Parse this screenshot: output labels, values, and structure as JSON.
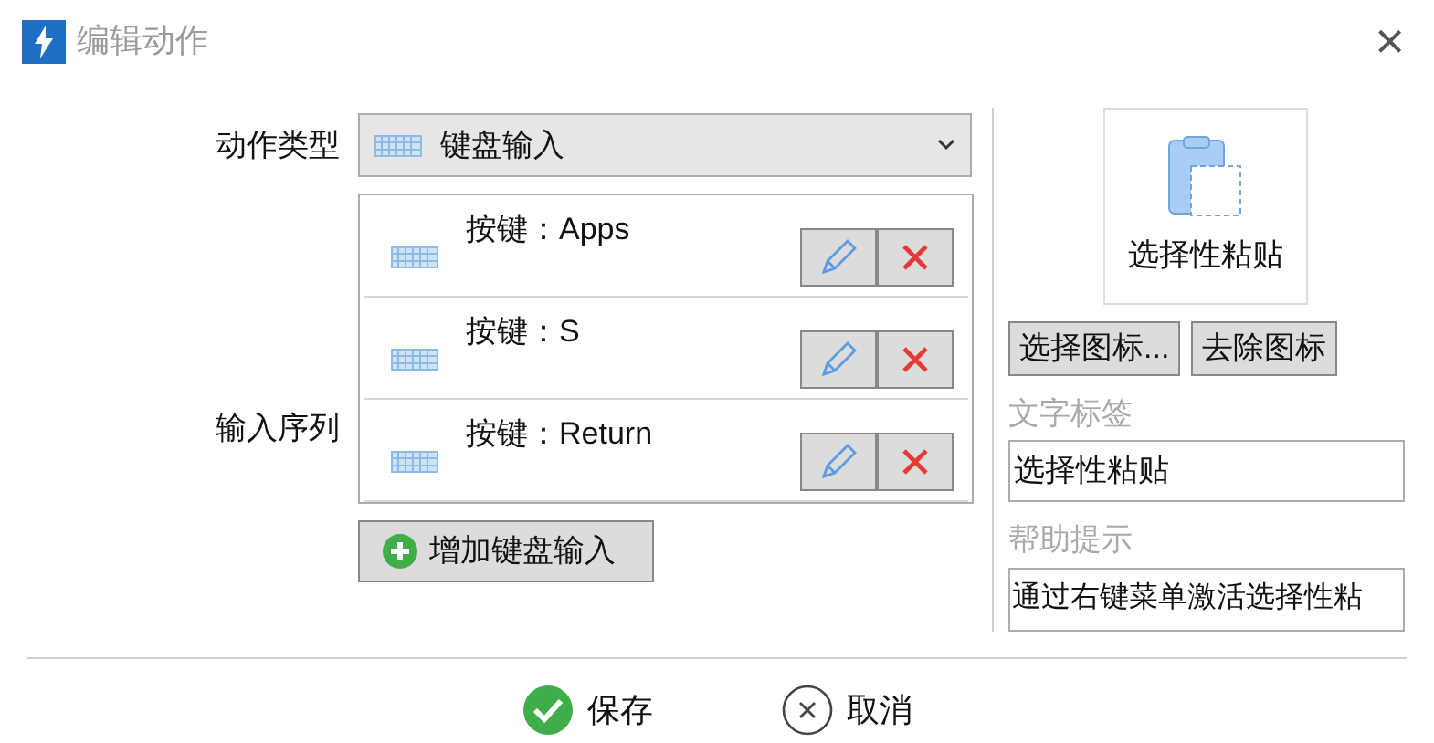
{
  "window": {
    "title": "编辑动作",
    "close": "×"
  },
  "action_type": {
    "label": "动作类型",
    "value": "键盘输入"
  },
  "input_sequence": {
    "label": "输入序列",
    "items": [
      {
        "text": "按键：Apps"
      },
      {
        "text": "按键：S"
      },
      {
        "text": "按键：Return"
      }
    ],
    "add_button": "增加键盘输入"
  },
  "icon_preview": {
    "caption": "选择性粘贴"
  },
  "icon_buttons": [
    "选择图标...",
    "去除图标"
  ],
  "text_label": {
    "label": "文字标签",
    "value": "选择性粘贴"
  },
  "help_tip": {
    "label": "帮助提示",
    "value": "通过右键菜单激活选择性粘"
  },
  "footer": {
    "save": "保存",
    "cancel": "取消"
  }
}
